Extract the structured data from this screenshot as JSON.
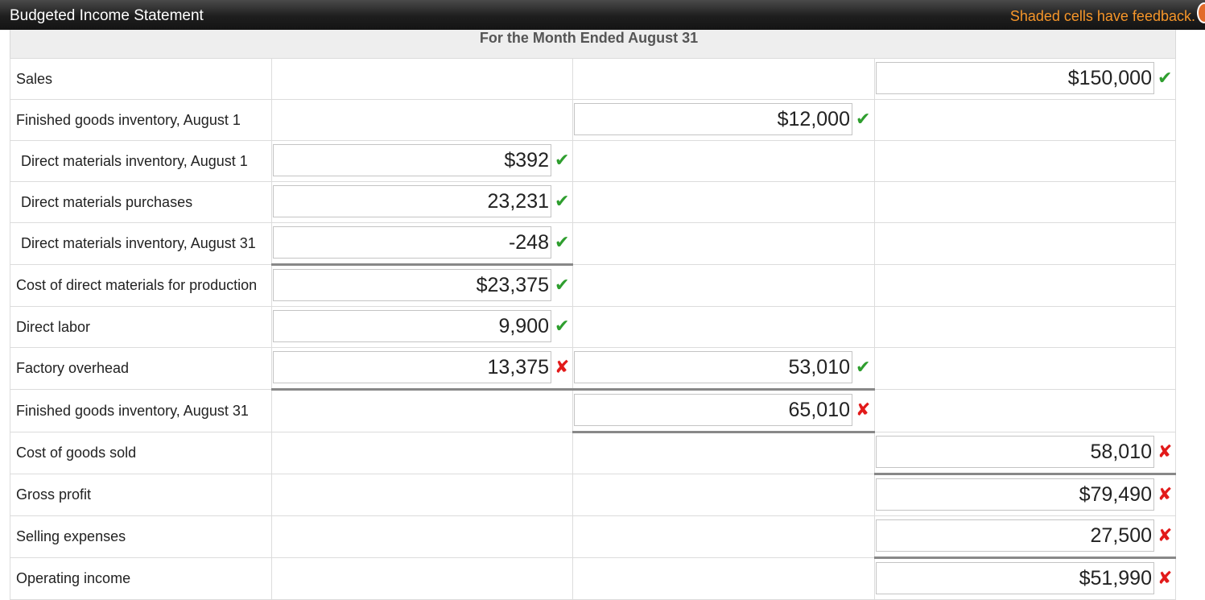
{
  "header": {
    "title": "Budgeted Income Statement",
    "feedback_note": "Shaded cells have feedback."
  },
  "statement": {
    "period": "For the Month Ended August 31",
    "rows": [
      {
        "label": "Sales"
      },
      {
        "label": "Finished goods inventory, August 1"
      },
      {
        "label": "Direct materials inventory, August 1"
      },
      {
        "label": "Direct materials purchases"
      },
      {
        "label": "Direct materials inventory, August 31"
      },
      {
        "label": "Cost of direct materials for production"
      },
      {
        "label": "Direct labor"
      },
      {
        "label": "Factory overhead"
      },
      {
        "label": "Finished goods inventory, August 31"
      },
      {
        "label": "Cost of goods sold"
      },
      {
        "label": "Gross profit"
      },
      {
        "label": "Selling expenses"
      },
      {
        "label": "Operating income"
      }
    ],
    "values": {
      "sales": "$150,000",
      "fg_inventory_aug1": "$12,000",
      "dm_inventory_aug1": "$392",
      "dm_purchases": "23,231",
      "dm_inventory_aug31": "-248",
      "dm_cost": "$23,375",
      "direct_labor": "9,900",
      "factory_overhead": "13,375",
      "total_manufacturing": "53,010",
      "goods_available": "65,010",
      "cogs": "58,010",
      "gross_profit": "$79,490",
      "selling_expenses": "27,500",
      "operating_income": "$51,990"
    },
    "marks": {
      "correct": "✔",
      "incorrect": "✘"
    }
  },
  "colors": {
    "correct": "#2e9e2e",
    "incorrect": "#e21a1a",
    "feedback": "#f6962a"
  }
}
